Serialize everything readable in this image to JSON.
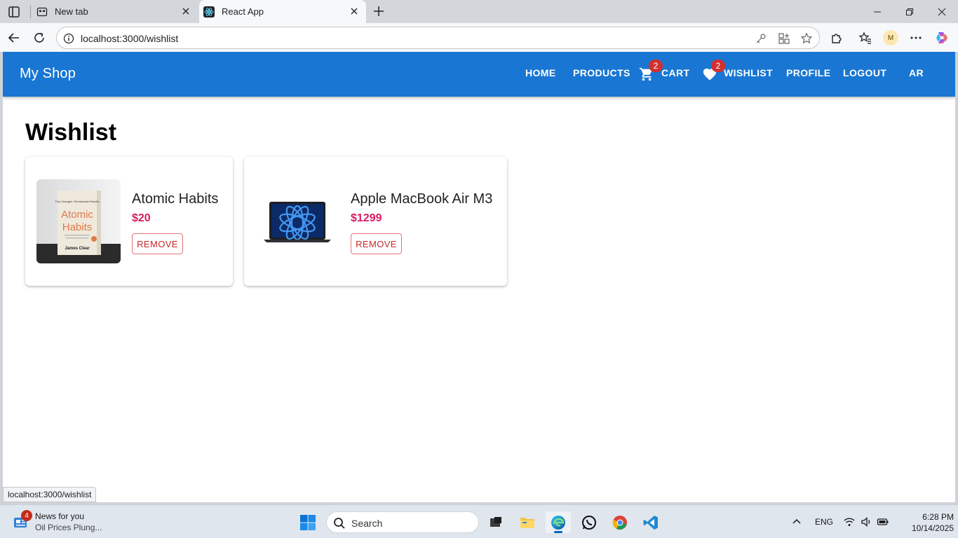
{
  "browser": {
    "tabs": [
      {
        "title": "New tab",
        "active": false
      },
      {
        "title": "React App",
        "active": true
      }
    ],
    "url": "localhost:3000/wishlist",
    "profile_initial": "M",
    "status_url": "localhost:3000/wishlist"
  },
  "app": {
    "brand": "My Shop",
    "nav": {
      "home": "HOME",
      "products": "PRODUCTS",
      "cart": "CART",
      "cart_count": "2",
      "wishlist": "WISHLIST",
      "wishlist_count": "2",
      "profile": "PROFILE",
      "logout": "LOGOUT",
      "language": "AR"
    },
    "colors": {
      "appbar": "#1976d2",
      "price": "#d81b60",
      "badge": "#d32f2f",
      "remove": "#c62828"
    }
  },
  "page": {
    "title": "Wishlist",
    "items": [
      {
        "name": "Atomic Habits",
        "price": "$20",
        "remove_label": "REMOVE",
        "image": "book-cover",
        "book_tagline": "Tiny Changes, Remarkable Results",
        "book_title_1": "Atomic",
        "book_title_2": "Habits",
        "book_author": "James Clear"
      },
      {
        "name": "Apple MacBook Air M3",
        "price": "$1299",
        "remove_label": "REMOVE",
        "image": "laptop"
      }
    ]
  },
  "taskbar": {
    "news_title": "News for you",
    "news_sub": "Oil Prices Plung...",
    "news_badge": "4",
    "search_label": "Search",
    "lang": "ENG",
    "time": "6:28 PM",
    "date": "10/14/2025"
  }
}
